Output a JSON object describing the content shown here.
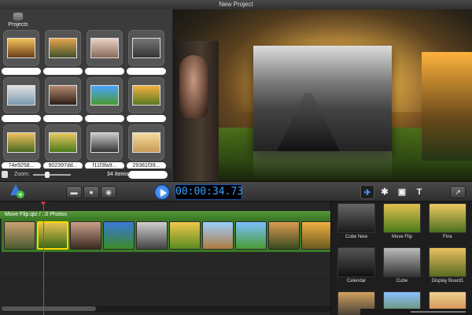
{
  "window": {
    "title": "New Project"
  },
  "media": {
    "projects_label": "Projects",
    "thumbnails": [
      {
        "label": "",
        "colors": [
          "#f4c35b",
          "#6a3e1a"
        ]
      },
      {
        "label": "",
        "colors": [
          "#e6a54f",
          "#40522a"
        ]
      },
      {
        "label": "",
        "colors": [
          "#e9d2c4",
          "#8a6a5a"
        ]
      },
      {
        "label": "",
        "colors": [
          "#777",
          "#333"
        ]
      },
      {
        "label": "",
        "colors": [
          "#e0e0e0",
          "#7a9ab0"
        ]
      },
      {
        "label": "",
        "colors": [
          "#b58a70",
          "#2a1c15"
        ]
      },
      {
        "label": "",
        "colors": [
          "#4aa3ff",
          "#4a9a30"
        ]
      },
      {
        "label": "",
        "colors": [
          "#f0b040",
          "#5a7a20"
        ]
      },
      {
        "label": "74e9258...",
        "colors": [
          "#f0c060",
          "#4a6a20"
        ]
      },
      {
        "label": "902397dd...",
        "colors": [
          "#e8c860",
          "#4a7a18"
        ]
      },
      {
        "label": "f11f3fa9...",
        "colors": [
          "#ccc",
          "#333"
        ]
      },
      {
        "label": "29381f39...",
        "colors": [
          "#f5dca0",
          "#c89a55"
        ]
      }
    ],
    "zoom_label": "Zoom:",
    "zoom_level": 0.35,
    "item_count": "34 items"
  },
  "toolbar": {
    "media_buttons": [
      "▬",
      "●",
      "◉"
    ],
    "timecode": "00:00:34.73",
    "tool_icons": [
      "✈",
      "✱",
      "▣",
      "T"
    ],
    "share_icon": "↗"
  },
  "timeline": {
    "track_title": "Move Flip.qtz / 10 Photos",
    "clips": [
      {
        "colors": [
          "#c9a070",
          "#4a5a30"
        ],
        "selected": false
      },
      {
        "colors": [
          "#e3c050",
          "#3e6a18"
        ],
        "selected": true
      },
      {
        "colors": [
          "#caa08a",
          "#3a2820"
        ],
        "selected": false
      },
      {
        "colors": [
          "#3a78d8",
          "#3c8a28"
        ],
        "selected": false
      },
      {
        "colors": [
          "#cfcfcf",
          "#444"
        ],
        "selected": false
      },
      {
        "colors": [
          "#f0c84a",
          "#5a8a20"
        ],
        "selected": false
      },
      {
        "colors": [
          "#9ad0ff",
          "#b07a40"
        ],
        "selected": false
      },
      {
        "colors": [
          "#7ac0ff",
          "#4a9a30"
        ],
        "selected": false
      },
      {
        "colors": [
          "#d89a50",
          "#3a4a20"
        ],
        "selected": false
      },
      {
        "colors": [
          "#f0b040",
          "#6a5a20"
        ],
        "selected": false
      }
    ],
    "playhead": 0.13
  },
  "transitions": [
    {
      "label": "Cube New",
      "colors": [
        "#666",
        "#1a1a1a"
      ]
    },
    {
      "label": "Move Flip",
      "colors": [
        "#e0c050",
        "#4a7a18"
      ]
    },
    {
      "label": "Fine",
      "colors": [
        "#f0c860",
        "#4a7020"
      ]
    },
    {
      "label": "Calendar",
      "colors": [
        "#555",
        "#111"
      ]
    },
    {
      "label": "Cube",
      "colors": [
        "#bbb",
        "#333"
      ]
    },
    {
      "label": "Display Board1",
      "colors": [
        "#e8c060",
        "#5a6a20"
      ]
    },
    {
      "label": "",
      "colors": [
        "#d0a060",
        "#2a2a2a"
      ]
    },
    {
      "label": "",
      "colors": [
        "#8ac0ff",
        "#5a7a30"
      ]
    },
    {
      "label": "",
      "colors": [
        "#eed090",
        "#c07030"
      ]
    }
  ]
}
